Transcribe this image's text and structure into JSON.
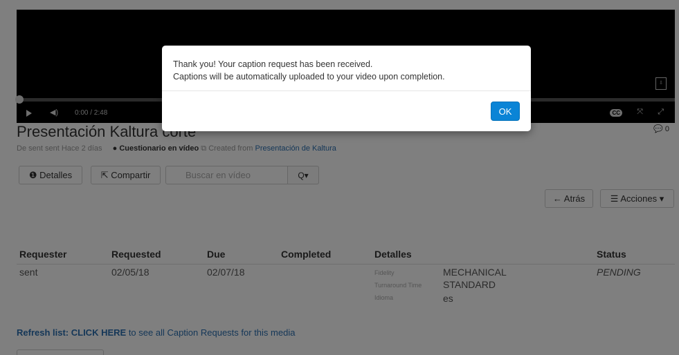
{
  "player": {
    "current_time": "0:00",
    "duration": "/ 2:48",
    "cc_label": "CC",
    "progress": 0
  },
  "entry": {
    "title": "Presentación Kaltura corte",
    "comment_count": "0",
    "owner": "De sent sent",
    "created_ago": "Hace 2 días",
    "type_label": "Cuestionario en vídeo",
    "created_from_label": "Created from",
    "created_from_link": "Presentación de Kaltura"
  },
  "toolbar": {
    "details_label": "Detalles",
    "share_label": "Compartir",
    "search_placeholder": "Buscar en vídeo",
    "search_button_label": "Q▾",
    "back_label": "Atrás",
    "actions_label": "Acciones"
  },
  "caption_table": {
    "headers": [
      "Requester",
      "Requested",
      "Due",
      "Completed",
      "Detalles",
      "Status"
    ],
    "rows": [
      {
        "requester": "sent",
        "requested": "02/05/18",
        "due": "02/07/18",
        "completed": "",
        "details": [
          {
            "label": "Fidelity",
            "value": "MECHANICAL"
          },
          {
            "label": "Turnaround Time",
            "value": "STANDARD"
          },
          {
            "label": "Idioma",
            "value": "es"
          }
        ],
        "status": "PENDING"
      }
    ]
  },
  "refresh": {
    "link_text": "Refresh list: CLICK HERE",
    "rest_text": " to see all Caption Requests for this media"
  },
  "modal": {
    "line1": "Thank you! Your caption request has been received.",
    "line2": "Captions will be automatically uploaded to your video upon completion.",
    "ok_label": "OK"
  },
  "colors": {
    "accent": "#0a84d6",
    "link": "#2a6fb0"
  }
}
